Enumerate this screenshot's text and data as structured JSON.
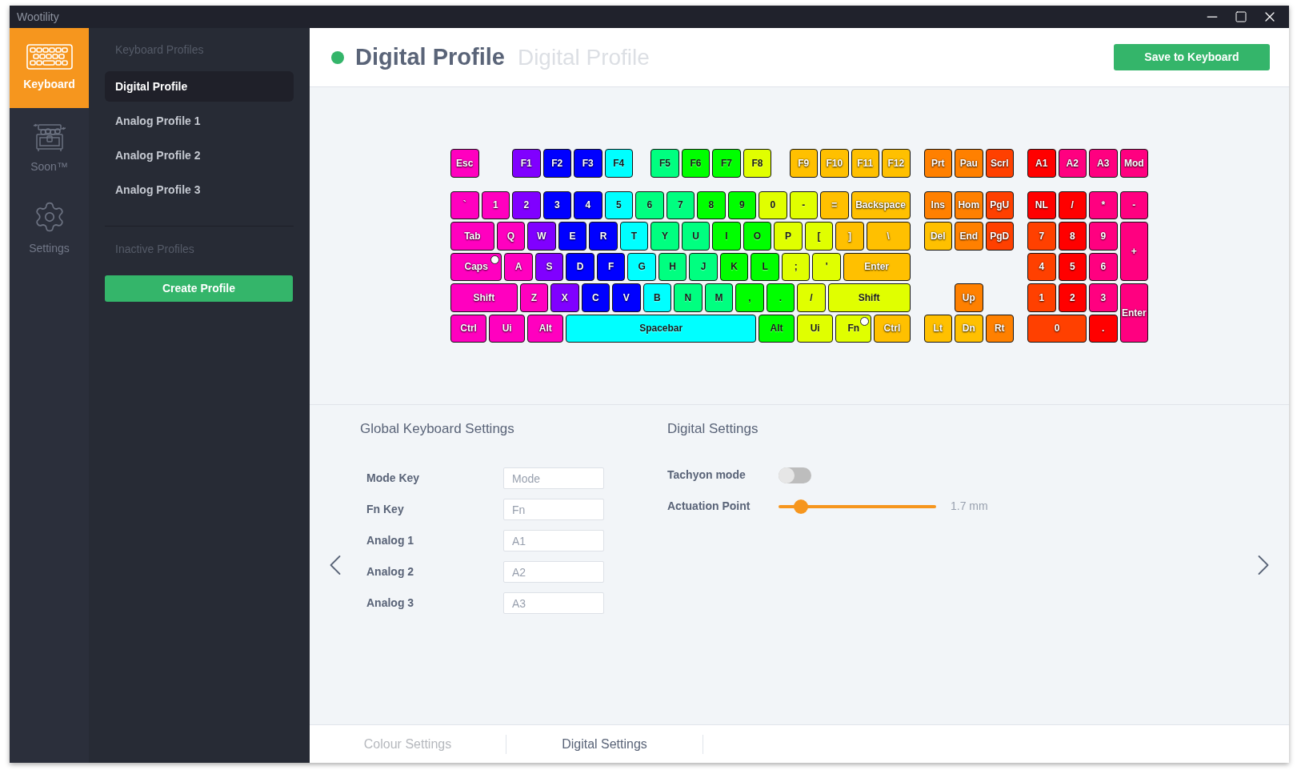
{
  "window": {
    "title": "Wootility"
  },
  "nav": [
    {
      "kind": "keyboard",
      "label": "Keyboard",
      "selected": true
    },
    {
      "kind": "chest",
      "label": "Soon™",
      "selected": false
    },
    {
      "kind": "gear",
      "label": "Settings",
      "selected": false
    }
  ],
  "profiles": {
    "heading": "Keyboard Profiles",
    "items": [
      {
        "label": "Digital Profile",
        "selected": true
      },
      {
        "label": "Analog Profile 1",
        "selected": false
      },
      {
        "label": "Analog Profile 2",
        "selected": false
      },
      {
        "label": "Analog Profile 3",
        "selected": false
      }
    ],
    "inactive_heading": "Inactive Profiles",
    "create_button": "Create Profile"
  },
  "header": {
    "active": true,
    "title": "Digital Profile",
    "name_placeholder": "Digital Profile",
    "save_button": "Save to Keyboard"
  },
  "keyboard": {
    "function_row": [
      [
        {
          "label": "Esc",
          "color": "#ff00bf",
          "indicator": false
        }
      ],
      [
        {
          "label": "F1",
          "color": "#8000ff",
          "indicator": false
        },
        {
          "label": "F2",
          "color": "#0000ff",
          "indicator": false
        },
        {
          "label": "F3",
          "color": "#0000ff",
          "indicator": false
        },
        {
          "label": "F4",
          "color": "#00ffff",
          "indicator": false
        }
      ],
      [
        {
          "label": "F5",
          "color": "#00ff80",
          "indicator": false
        },
        {
          "label": "F6",
          "color": "#00ff00",
          "indicator": false
        },
        {
          "label": "F7",
          "color": "#00ff00",
          "indicator": false
        },
        {
          "label": "F8",
          "color": "#e0ff00",
          "indicator": false
        }
      ],
      [
        {
          "label": "F9",
          "color": "#ffc000",
          "indicator": false
        },
        {
          "label": "F10",
          "color": "#ffc000",
          "indicator": false
        },
        {
          "label": "F11",
          "color": "#ffc000",
          "indicator": false
        },
        {
          "label": "F12",
          "color": "#ffc000",
          "indicator": false
        }
      ]
    ],
    "top_nav": [
      {
        "label": "Prt",
        "color": "#ff8000",
        "indicator": false
      },
      {
        "label": "Pau",
        "color": "#ff8000",
        "indicator": false
      },
      {
        "label": "Scrl",
        "color": "#ff4000",
        "indicator": false
      }
    ],
    "analog_row": [
      {
        "label": "A1",
        "color": "#ff0000",
        "indicator": false
      },
      {
        "label": "A2",
        "color": "#ff0080",
        "indicator": false
      },
      {
        "label": "A3",
        "color": "#ff0080",
        "indicator": false
      },
      {
        "label": "Mod",
        "color": "#ff0080",
        "indicator": false
      }
    ],
    "main_rows": [
      [
        {
          "label": "`",
          "color": "#ff00bf",
          "indicator": false
        },
        {
          "label": "1",
          "color": "#ff00bf",
          "indicator": false
        },
        {
          "label": "2",
          "color": "#8000ff",
          "indicator": false
        },
        {
          "label": "3",
          "color": "#0000ff",
          "indicator": false
        },
        {
          "label": "4",
          "color": "#0000ff",
          "indicator": false
        },
        {
          "label": "5",
          "color": "#00ffff",
          "indicator": false
        },
        {
          "label": "6",
          "color": "#00ff80",
          "indicator": false
        },
        {
          "label": "7",
          "color": "#00ff80",
          "indicator": false
        },
        {
          "label": "8",
          "color": "#00ff00",
          "indicator": false
        },
        {
          "label": "9",
          "color": "#00ff00",
          "indicator": false
        },
        {
          "label": "0",
          "color": "#e0ff00",
          "indicator": false
        },
        {
          "label": "-",
          "color": "#e0ff00",
          "indicator": false
        },
        {
          "label": "=",
          "color": "#ffc000",
          "indicator": false
        },
        {
          "label": "Backspace",
          "color": "#ffc000",
          "indicator": false
        }
      ],
      [
        {
          "label": "Tab",
          "color": "#ff00bf",
          "indicator": false
        },
        {
          "label": "Q",
          "color": "#ff00bf",
          "indicator": false
        },
        {
          "label": "W",
          "color": "#8000ff",
          "indicator": false
        },
        {
          "label": "E",
          "color": "#0000ff",
          "indicator": false
        },
        {
          "label": "R",
          "color": "#0000ff",
          "indicator": false
        },
        {
          "label": "T",
          "color": "#00ffff",
          "indicator": false
        },
        {
          "label": "Y",
          "color": "#00ff80",
          "indicator": false
        },
        {
          "label": "U",
          "color": "#00ff80",
          "indicator": false
        },
        {
          "label": "I",
          "color": "#00ff00",
          "indicator": false
        },
        {
          "label": "O",
          "color": "#00ff00",
          "indicator": false
        },
        {
          "label": "P",
          "color": "#e0ff00",
          "indicator": false
        },
        {
          "label": "[",
          "color": "#e0ff00",
          "indicator": false
        },
        {
          "label": "]",
          "color": "#ffc000",
          "indicator": false
        },
        {
          "label": "\\",
          "color": "#ffc000",
          "indicator": false
        }
      ],
      [
        {
          "label": "Caps",
          "color": "#ff00bf",
          "indicator": true
        },
        {
          "label": "A",
          "color": "#ff00bf",
          "indicator": false
        },
        {
          "label": "S",
          "color": "#8000ff",
          "indicator": false
        },
        {
          "label": "D",
          "color": "#0000ff",
          "indicator": false
        },
        {
          "label": "F",
          "color": "#0000ff",
          "indicator": false
        },
        {
          "label": "G",
          "color": "#00ffff",
          "indicator": false
        },
        {
          "label": "H",
          "color": "#00ff80",
          "indicator": false
        },
        {
          "label": "J",
          "color": "#00ff80",
          "indicator": false
        },
        {
          "label": "K",
          "color": "#00ff00",
          "indicator": false
        },
        {
          "label": "L",
          "color": "#00ff00",
          "indicator": false
        },
        {
          "label": ";",
          "color": "#e0ff00",
          "indicator": false
        },
        {
          "label": "'",
          "color": "#e0ff00",
          "indicator": false
        },
        {
          "label": "Enter",
          "color": "#ffc000",
          "indicator": false
        }
      ],
      [
        {
          "label": "Shift",
          "color": "#ff00bf",
          "indicator": false
        },
        {
          "label": "Z",
          "color": "#ff00bf",
          "indicator": false
        },
        {
          "label": "X",
          "color": "#8000ff",
          "indicator": false
        },
        {
          "label": "C",
          "color": "#0000ff",
          "indicator": false
        },
        {
          "label": "V",
          "color": "#0000ff",
          "indicator": false
        },
        {
          "label": "B",
          "color": "#00ffff",
          "indicator": false
        },
        {
          "label": "N",
          "color": "#00ff80",
          "indicator": false
        },
        {
          "label": "M",
          "color": "#00ff80",
          "indicator": false
        },
        {
          "label": ",",
          "color": "#00ff00",
          "indicator": false
        },
        {
          "label": ".",
          "color": "#00ff00",
          "indicator": false
        },
        {
          "label": "/",
          "color": "#e0ff00",
          "indicator": false
        },
        {
          "label": "Shift",
          "color": "#e0ff00",
          "indicator": false
        }
      ],
      [
        {
          "label": "Ctrl",
          "color": "#ff00bf",
          "indicator": false
        },
        {
          "label": "Ui",
          "color": "#ff00bf",
          "indicator": false
        },
        {
          "label": "Alt",
          "color": "#ff00bf",
          "indicator": false
        },
        {
          "label": "Spacebar",
          "color": "#00ffff",
          "indicator": false
        },
        {
          "label": "Alt",
          "color": "#00ff00",
          "indicator": false
        },
        {
          "label": "Ui",
          "color": "#e0ff00",
          "indicator": false
        },
        {
          "label": "Fn",
          "color": "#e0ff00",
          "indicator": true
        },
        {
          "label": "Ctrl",
          "color": "#ffc000",
          "indicator": false
        }
      ]
    ],
    "nav_cluster": [
      {
        "label": "Ins",
        "color": "#ff8000",
        "indicator": false
      },
      {
        "label": "Hom",
        "color": "#ff8000",
        "indicator": false
      },
      {
        "label": "PgU",
        "color": "#ff4000",
        "indicator": false
      },
      {
        "label": "Del",
        "color": "#ffc000",
        "indicator": false
      },
      {
        "label": "End",
        "color": "#ff8000",
        "indicator": false
      },
      {
        "label": "PgD",
        "color": "#ff4000",
        "indicator": false
      },
      {
        "label": "Up",
        "color": "#ff8000",
        "indicator": false
      },
      {
        "label": "Lt",
        "color": "#ffc000",
        "indicator": false
      },
      {
        "label": "Dn",
        "color": "#ffc000",
        "indicator": false
      },
      {
        "label": "Rt",
        "color": "#ff8000",
        "indicator": false
      }
    ],
    "numpad": [
      {
        "label": "NL",
        "color": "#ff0000",
        "indicator": false
      },
      {
        "label": "/",
        "color": "#ff0000",
        "indicator": false
      },
      {
        "label": "*",
        "color": "#ff0080",
        "indicator": false
      },
      {
        "label": "-",
        "color": "#ff0080",
        "indicator": false
      },
      {
        "label": "7",
        "color": "#ff4000",
        "indicator": false
      },
      {
        "label": "8",
        "color": "#ff0000",
        "indicator": false
      },
      {
        "label": "9",
        "color": "#ff0080",
        "indicator": false
      },
      {
        "label": "+",
        "color": "#ff0080",
        "indicator": false
      },
      {
        "label": "4",
        "color": "#ff4000",
        "indicator": false
      },
      {
        "label": "5",
        "color": "#ff0000",
        "indicator": false
      },
      {
        "label": "6",
        "color": "#ff0080",
        "indicator": false
      },
      {
        "label": "1",
        "color": "#ff4000",
        "indicator": false
      },
      {
        "label": "2",
        "color": "#ff0000",
        "indicator": false
      },
      {
        "label": "3",
        "color": "#ff0080",
        "indicator": false
      },
      {
        "label": "Enter",
        "color": "#ff0080",
        "indicator": false
      },
      {
        "label": "0",
        "color": "#ff4000",
        "indicator": false
      },
      {
        "label": ".",
        "color": "#ff0000",
        "indicator": false
      }
    ]
  },
  "global_settings": {
    "heading": "Global Keyboard Settings",
    "fields": [
      {
        "label": "Mode Key",
        "placeholder": "Mode"
      },
      {
        "label": "Fn Key",
        "placeholder": "Fn"
      },
      {
        "label": "Analog 1",
        "placeholder": "A1"
      },
      {
        "label": "Analog 2",
        "placeholder": "A2"
      },
      {
        "label": "Analog 3",
        "placeholder": "A3"
      }
    ]
  },
  "digital_settings": {
    "heading": "Digital Settings",
    "tachyon": {
      "label": "Tachyon mode",
      "on": false
    },
    "actuation": {
      "label": "Actuation Point",
      "level": 0.14,
      "reading": "1.7 mm"
    }
  },
  "bottom_tabs": [
    {
      "label": "Colour Settings",
      "selected": false
    },
    {
      "label": "Digital Settings",
      "selected": true
    }
  ]
}
